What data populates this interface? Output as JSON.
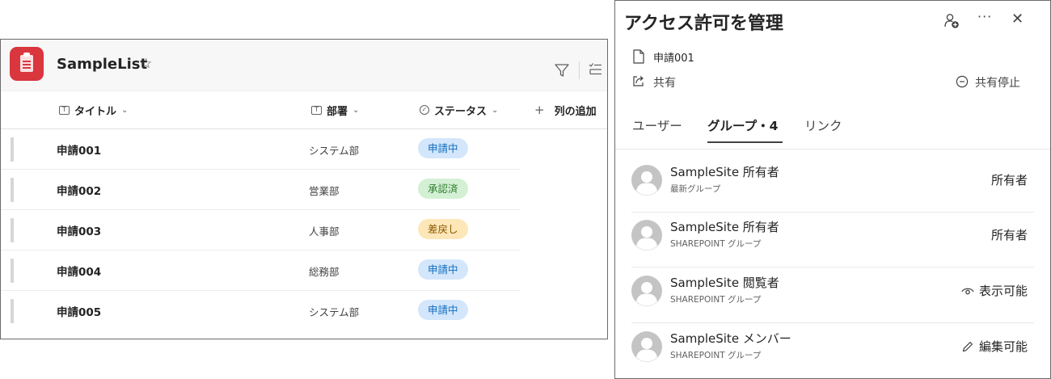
{
  "list": {
    "title": "SampleList",
    "columns": {
      "title": "タイトル",
      "department": "部署",
      "status": "ステータス",
      "add_column": "列の追加"
    },
    "rows": [
      {
        "title": "申請001",
        "department": "システム部",
        "status": "申請中"
      },
      {
        "title": "申請002",
        "department": "営業部",
        "status": "承認済"
      },
      {
        "title": "申請003",
        "department": "人事部",
        "status": "差戻し"
      },
      {
        "title": "申請004",
        "department": "総務部",
        "status": "申請中"
      },
      {
        "title": "申請005",
        "department": "システム部",
        "status": "申請中"
      }
    ],
    "status_colors": {
      "申請中": {
        "bg": "#d3e6fb",
        "fg": "#0f6cbd"
      },
      "承認済": {
        "bg": "#d4f0d4",
        "fg": "#2e7d32"
      },
      "差戻し": {
        "bg": "#fde7b8",
        "fg": "#8a5a00"
      }
    },
    "brand_color": "#d9363e"
  },
  "access": {
    "title": "アクセス許可を管理",
    "file_name": "申請001",
    "share_label": "共有",
    "stop_sharing_label": "共有停止",
    "tabs": [
      {
        "label": "ユーザー",
        "active": false
      },
      {
        "label": "グループ・4",
        "active": true
      },
      {
        "label": "リンク",
        "active": false
      }
    ],
    "members": [
      {
        "name": "SampleSite 所有者",
        "sub": "最新グループ",
        "role": "所有者",
        "role_icon": "none"
      },
      {
        "name": "SampleSite 所有者",
        "sub": "SHAREPOINT グループ",
        "role": "所有者",
        "role_icon": "none"
      },
      {
        "name": "SampleSite 閲覧者",
        "sub": "SHAREPOINT グループ",
        "role": "表示可能",
        "role_icon": "eye-icon"
      },
      {
        "name": "SampleSite メンバー",
        "sub": "SHAREPOINT グループ",
        "role": "編集可能",
        "role_icon": "pencil-icon"
      }
    ]
  }
}
